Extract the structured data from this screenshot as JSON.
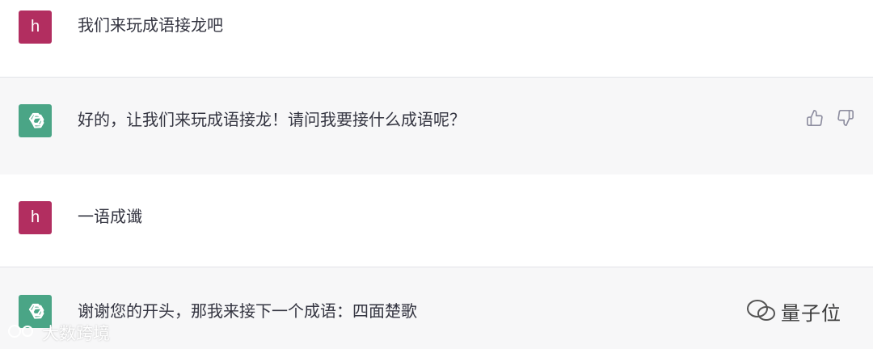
{
  "conversation": [
    {
      "role": "user",
      "avatar": "h",
      "text": "我们来玩成语接龙吧"
    },
    {
      "role": "assistant",
      "avatar": "openai-logo-icon",
      "text": "好的，让我们来玩成语接龙！请问我要接什么成语呢？"
    },
    {
      "role": "user",
      "avatar": "h",
      "text": "一语成谶"
    },
    {
      "role": "assistant",
      "avatar": "openai-logo-icon",
      "text": "谢谢您的开头，那我来接下一个成语：四面楚歌"
    }
  ],
  "colors": {
    "user_avatar": "#b22e60",
    "assistant_avatar": "#4aa586",
    "assistant_bg": "#f7f7f8"
  },
  "watermarks": {
    "left": "大数跨境",
    "right": "量子位"
  }
}
